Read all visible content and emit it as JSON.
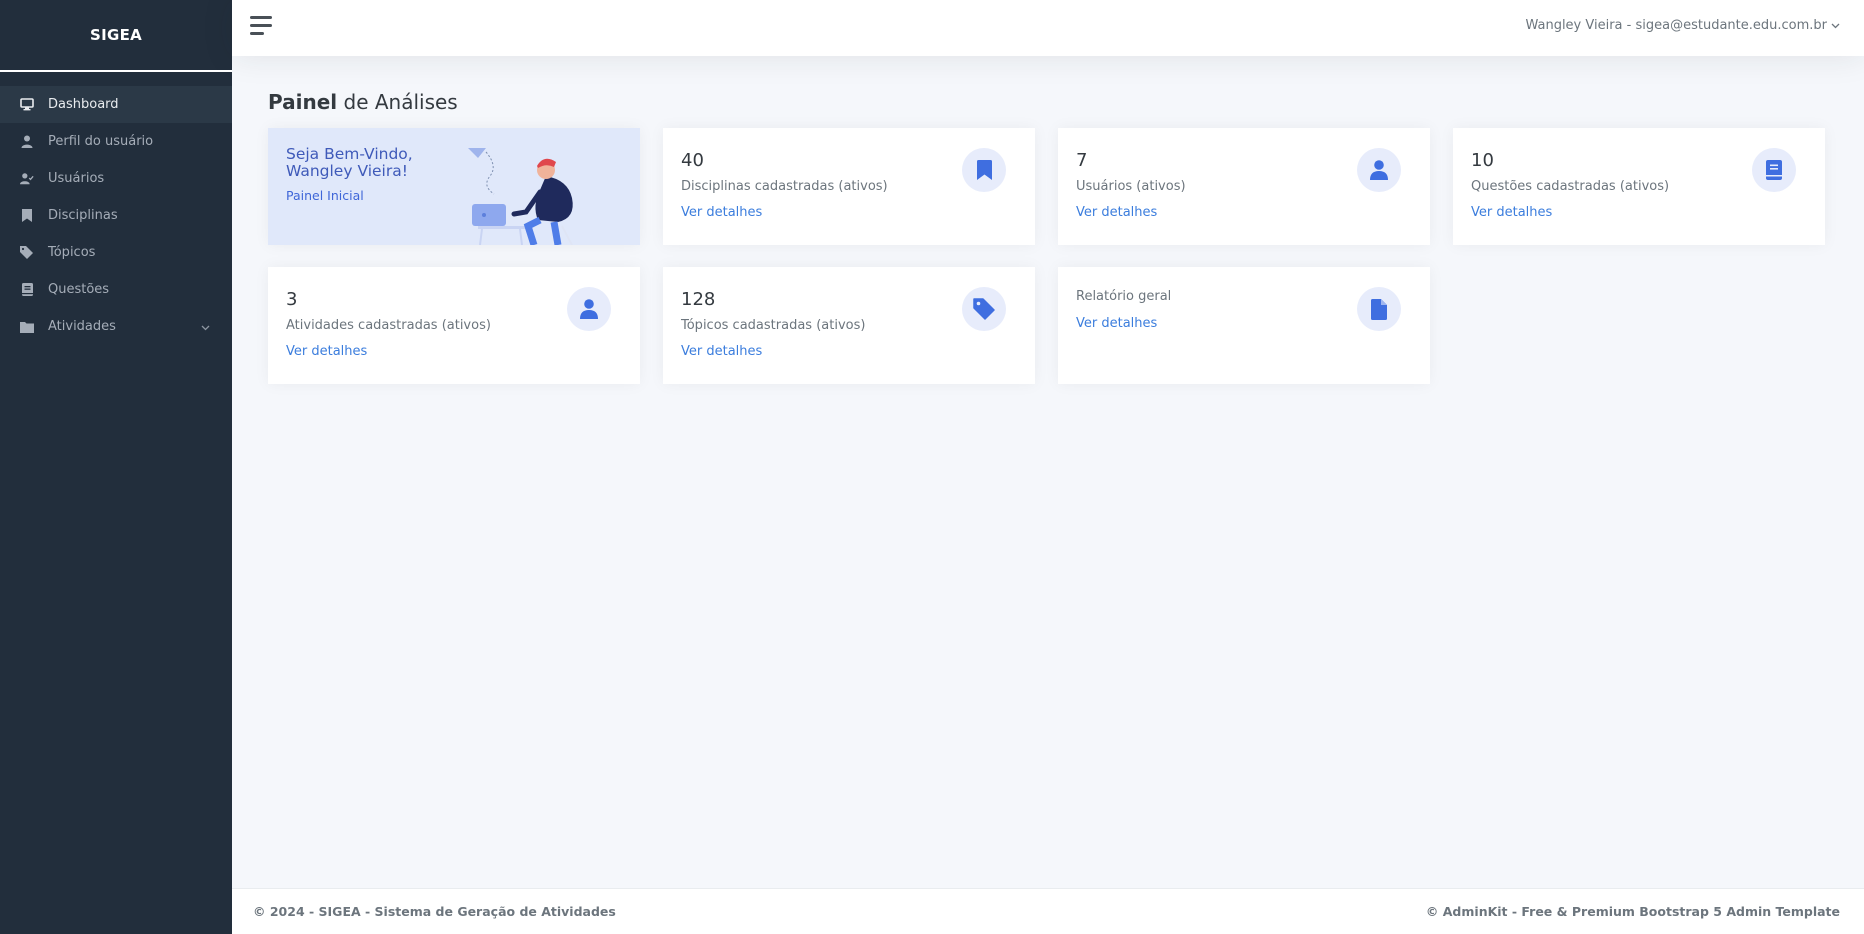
{
  "brand": "SIGEA",
  "colors": {
    "sidebar": "#222e3c",
    "accent": "#3b7ddd",
    "icon_circle": "#e7ecfb",
    "welcome_bg": "#e0e8fa"
  },
  "sidebar": {
    "items": [
      {
        "label": "Dashboard",
        "icon": "desktop-icon",
        "active": true
      },
      {
        "label": "Perfil do usuário",
        "icon": "user-icon"
      },
      {
        "label": "Usuários",
        "icon": "user-check-icon"
      },
      {
        "label": "Disciplinas",
        "icon": "bookmark-icon"
      },
      {
        "label": "Tópicos",
        "icon": "tags-icon"
      },
      {
        "label": "Questões",
        "icon": "book-icon"
      },
      {
        "label": "Atividades",
        "icon": "folder-icon",
        "expandable": true
      }
    ]
  },
  "topbar": {
    "user": "Wangley Vieira - sigea@estudante.edu.com.br"
  },
  "main": {
    "title_bold": "Painel",
    "title_rest": " de Análises",
    "welcome": {
      "greeting": "Seja Bem-Vindo,",
      "name": "Wangley Vieira!",
      "subtitle": "Painel Inicial"
    },
    "cards": [
      {
        "value": "40",
        "label": "Disciplinas cadastradas (ativos)",
        "link": "Ver detalhes",
        "icon": "bookmark-icon"
      },
      {
        "value": "7",
        "label": "Usuários (ativos)",
        "link": "Ver detalhes",
        "icon": "user-icon"
      },
      {
        "value": "10",
        "label": "Questões cadastradas (ativos)",
        "link": "Ver detalhes",
        "icon": "book-icon"
      },
      {
        "value": "3",
        "label": "Atividades cadastradas (ativos)",
        "link": "Ver detalhes",
        "icon": "user-icon"
      },
      {
        "value": "128",
        "label": "Tópicos cadastradas (ativos)",
        "link": "Ver detalhes",
        "icon": "tag-icon"
      },
      {
        "label": "Relatório geral",
        "link": "Ver detalhes",
        "icon": "file-icon"
      }
    ]
  },
  "footer": {
    "left": "© 2024 - SIGEA - Sistema de Geração de Atividades",
    "right": "© AdminKit - Free & Premium Bootstrap 5 Admin Template"
  }
}
